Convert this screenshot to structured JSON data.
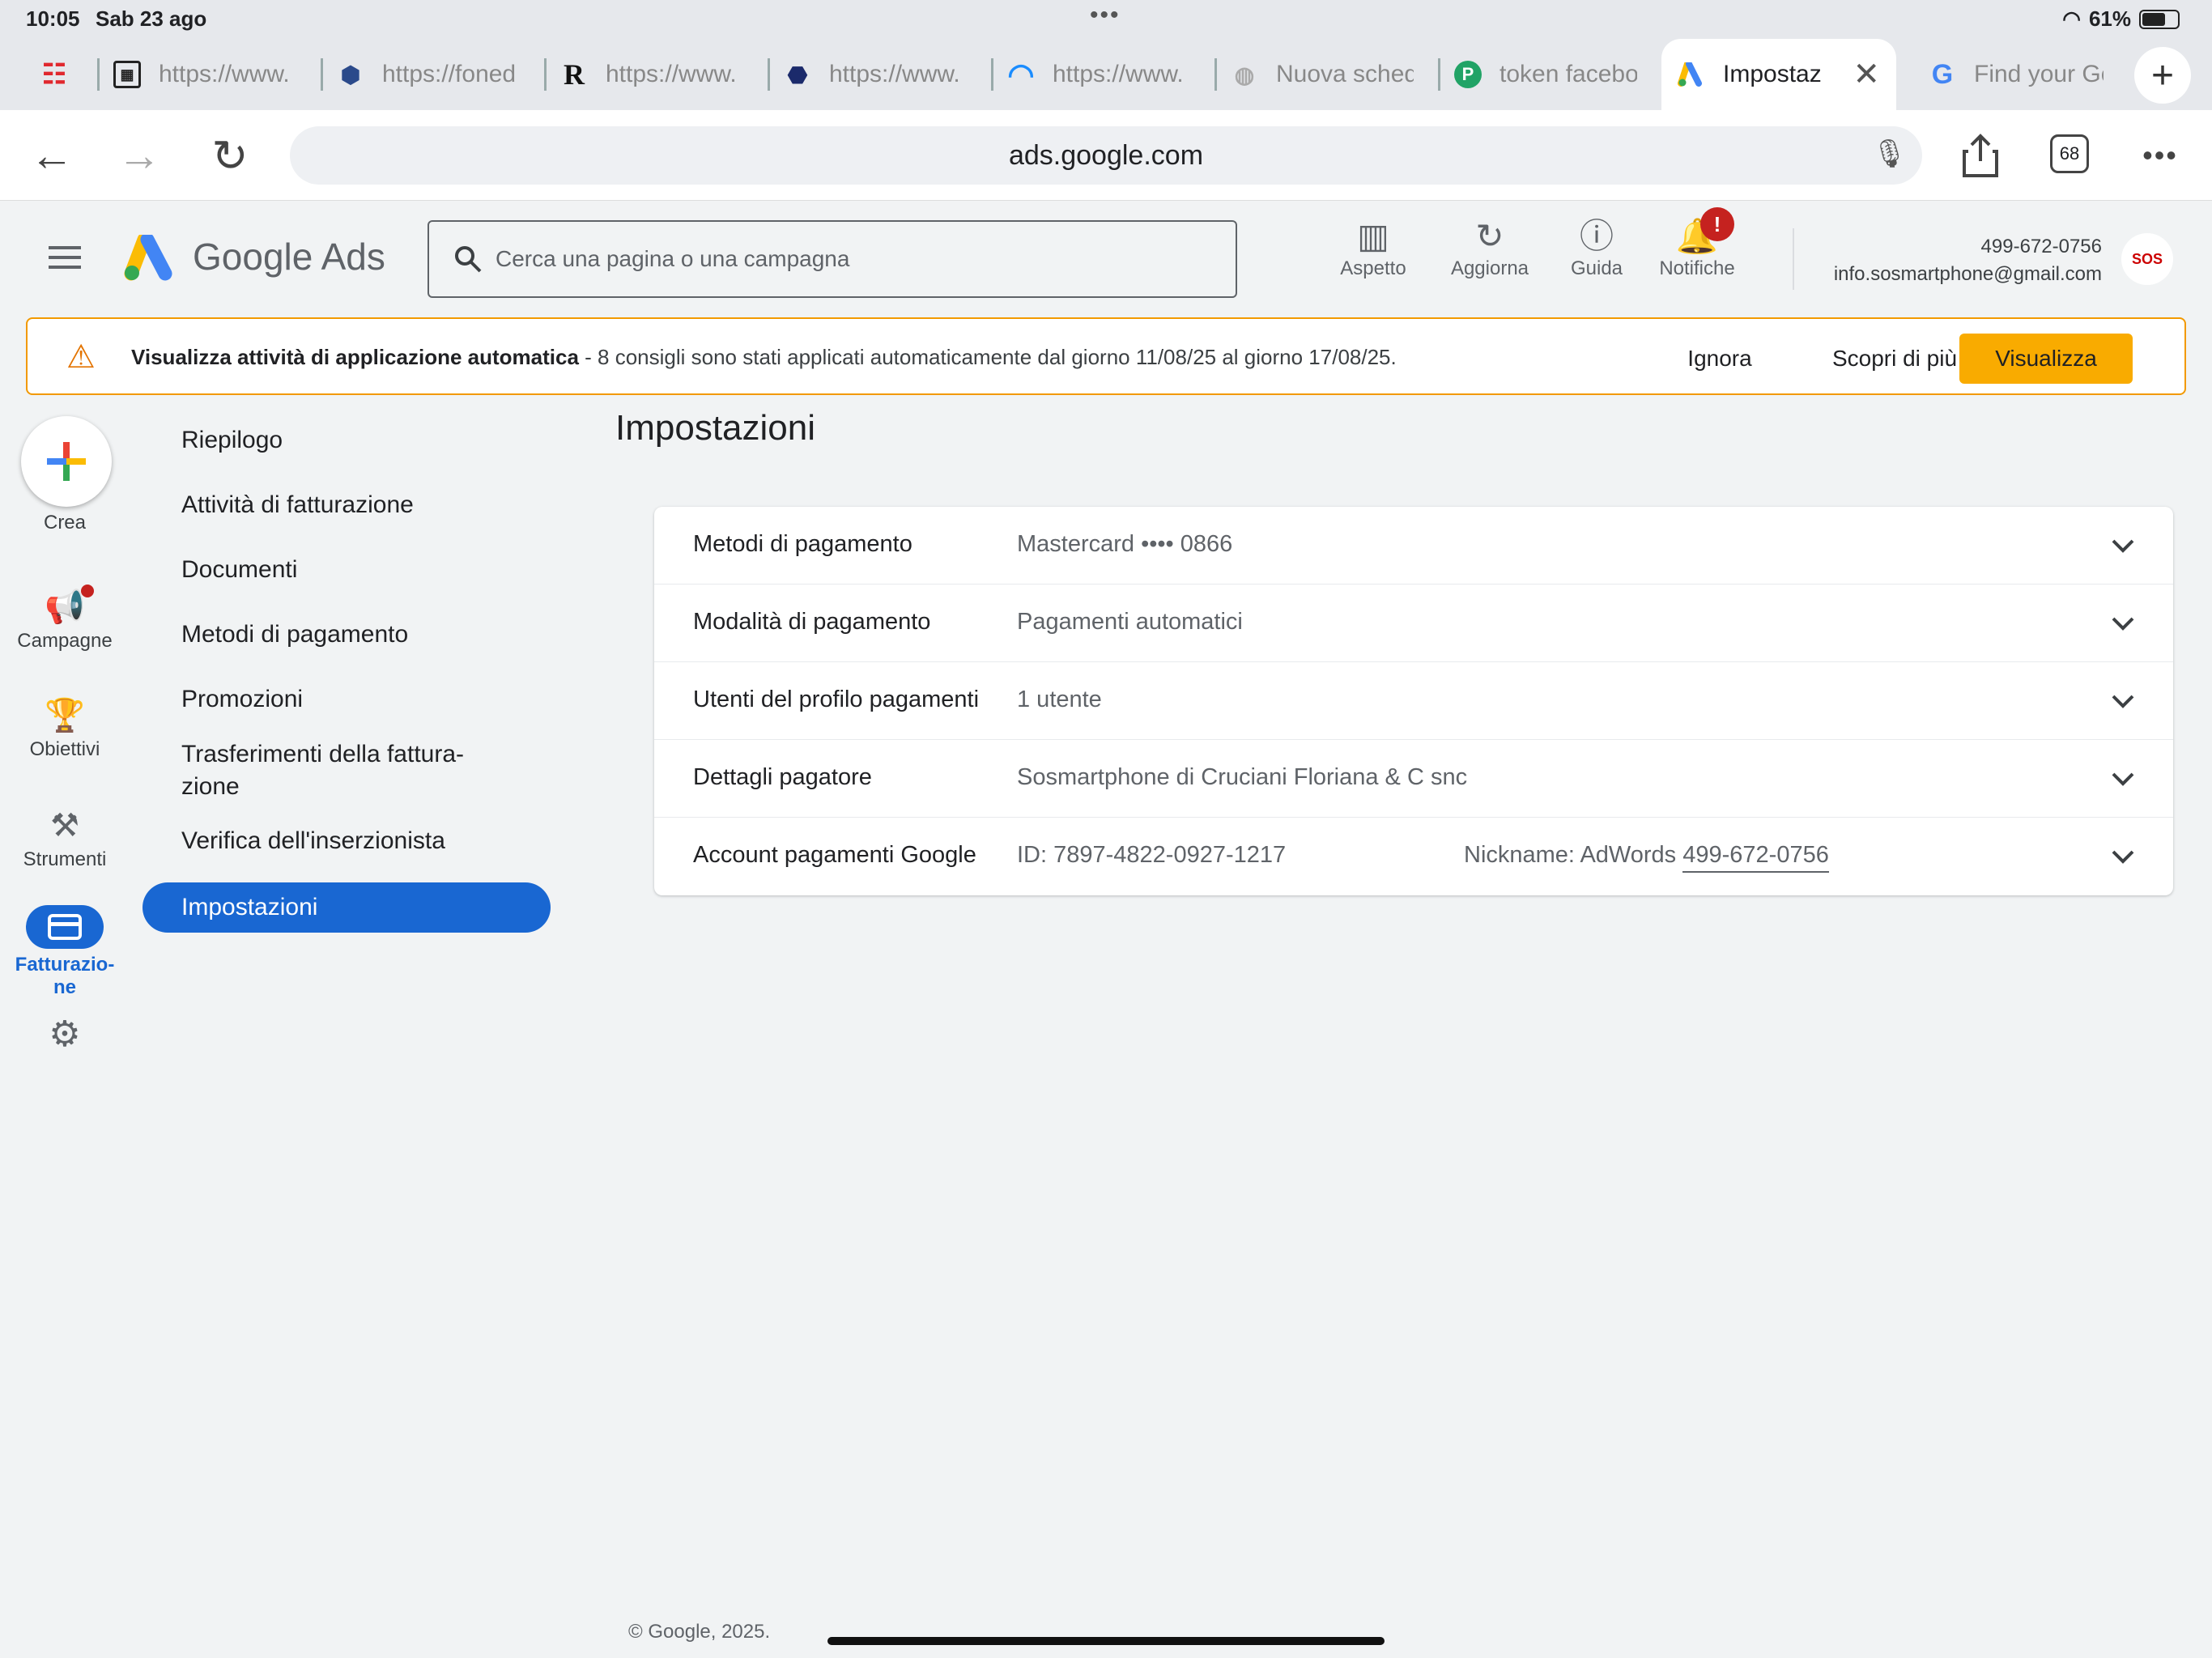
{
  "status_bar": {
    "time": "10:05",
    "date": "Sab 23 ago",
    "battery": "61%"
  },
  "tabs": [
    {
      "title": "https://www.",
      "icon": "grid-logo-icon"
    },
    {
      "title": "https://foned",
      "icon": "shield-favicon"
    },
    {
      "title": "https://www.",
      "icon": "r-favicon"
    },
    {
      "title": "https://www.",
      "icon": "s-favicon"
    },
    {
      "title": "https://www.",
      "icon": "arc-favicon"
    },
    {
      "title": "Nuova sched",
      "icon": "globe-icon"
    },
    {
      "title": "token facebo",
      "icon": "p-favicon"
    },
    {
      "title": "Impostaz",
      "icon": "google-ads-favicon",
      "active": true
    },
    {
      "title": "Find your Go",
      "icon": "google-favicon"
    }
  ],
  "address_bar": {
    "url": "ads.google.com",
    "tab_count": "68"
  },
  "header": {
    "product_name": "Google Ads",
    "search_placeholder": "Cerca una pagina o una campagna",
    "actions": {
      "appearance": "Aspetto",
      "refresh": "Aggiorna",
      "help": "Guida",
      "notifications": "Notifiche"
    },
    "notification_badge": "!",
    "account_id": "499-672-0756",
    "account_email": "info.sosmartphone@gmail.com",
    "avatar_text": "SOS"
  },
  "banner": {
    "title": "Visualizza attività di applicazione automatica",
    "message": " - 8 consigli sono stati applicati automaticamente dal giorno 11/08/25 al giorno 17/08/25.",
    "dismiss": "Ignora",
    "learn_more": "Scopri di più",
    "view": "Visualizza"
  },
  "rail": {
    "create": "Crea",
    "campaigns": "Campagne",
    "goals": "Obiettivi",
    "tools": "Strumenti",
    "billing_line1": "Fatturazio-",
    "billing_line2": "ne"
  },
  "subnav": {
    "summary": "Riepilogo",
    "billing_activity": "Attività di fatturazione",
    "documents": "Documenti",
    "payment_methods": "Metodi di pagamento",
    "promotions": "Promozioni",
    "transfers_line1": "Trasferimenti della fattura-",
    "transfers_line2": "zione",
    "advertiser_verification": "Verifica dell'inserzionista",
    "settings": "Impostazioni"
  },
  "main": {
    "page_title": "Impostazioni",
    "rows": [
      {
        "label": "Metodi di pagamento",
        "value": "Mastercard •••• 0866"
      },
      {
        "label": "Modalità di pagamento",
        "value": "Pagamenti automatici"
      },
      {
        "label": "Utenti del profilo pagamenti",
        "value": "1 utente"
      },
      {
        "label": "Dettagli pagatore",
        "value": "Sosmartphone di Cruciani Floriana & C snc"
      },
      {
        "label": "Account pagamenti Google",
        "value": "ID: 7897-4822-0927-1217",
        "nickname_prefix": "Nickname: AdWords ",
        "nickname_link": "499-672-0756"
      }
    ]
  },
  "footer": "© Google, 2025.",
  "colors": {
    "accent_blue": "#1967d2",
    "warning_orange": "#f29900",
    "visualizza_yellow": "#f9ab00",
    "badge_red": "#c5221f"
  }
}
